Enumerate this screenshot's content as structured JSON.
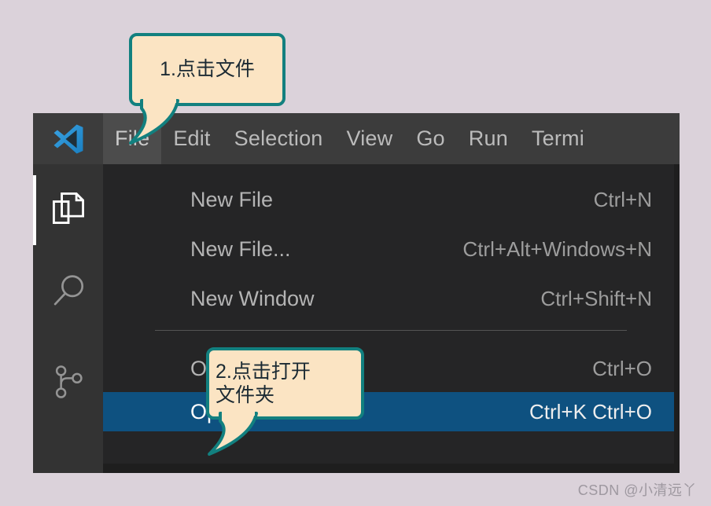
{
  "app": {
    "name": "Visual Studio Code",
    "logo_icon": "vscode-logo-icon",
    "background_color": "#dbd2da",
    "window_background": "#1e1e1e",
    "menubar_background": "#3c3c3c",
    "dropdown_background": "#252526",
    "highlight_color": "#0e5180",
    "callout_fill": "#fbe4c3",
    "callout_border": "#12807f"
  },
  "menubar": {
    "items": [
      {
        "label": "File",
        "active": true
      },
      {
        "label": "Edit",
        "active": false
      },
      {
        "label": "Selection",
        "active": false
      },
      {
        "label": "View",
        "active": false
      },
      {
        "label": "Go",
        "active": false
      },
      {
        "label": "Run",
        "active": false
      },
      {
        "label": "Termi",
        "active": false
      }
    ]
  },
  "activitybar": {
    "items": [
      {
        "icon": "explorer-files-icon",
        "active": true
      },
      {
        "icon": "search-magnifier-icon",
        "active": false
      },
      {
        "icon": "source-control-branch-icon",
        "active": false
      }
    ]
  },
  "file_menu": {
    "items": [
      {
        "label": "New File",
        "shortcut": "Ctrl+N",
        "highlighted": false
      },
      {
        "label": "New File...",
        "shortcut": "Ctrl+Alt+Windows+N",
        "highlighted": false
      },
      {
        "label": "New Window",
        "shortcut": "Ctrl+Shift+N",
        "highlighted": false
      },
      {
        "label": "Open File...",
        "shortcut": "Ctrl+O",
        "highlighted": false
      },
      {
        "label": "Open Folder...",
        "shortcut": "Ctrl+K Ctrl+O",
        "highlighted": true
      }
    ]
  },
  "callouts": [
    {
      "text": "1.点击文件",
      "target": "File menu"
    },
    {
      "text": "2.点击打开\n文件夹",
      "target": "Open Folder..."
    }
  ],
  "watermark": {
    "text": "CSDN @小清远丫"
  }
}
